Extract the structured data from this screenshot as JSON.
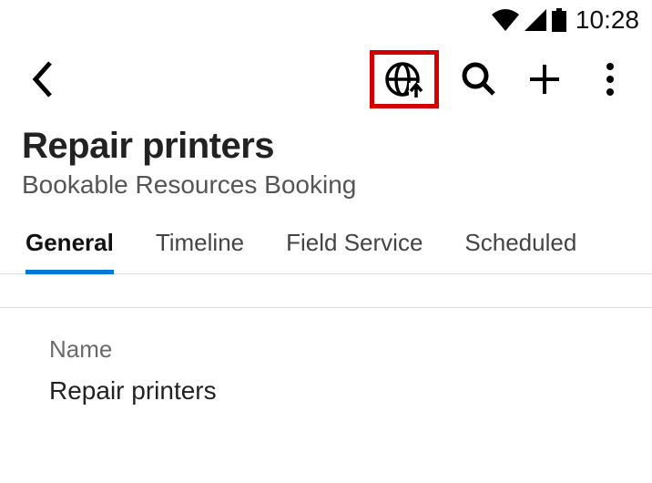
{
  "status": {
    "time": "10:28"
  },
  "appbar": {
    "highlighted_icon": "globe-upload-icon"
  },
  "header": {
    "title": "Repair printers",
    "subtitle": "Bookable Resources Booking"
  },
  "tabs": [
    {
      "label": "General",
      "active": true
    },
    {
      "label": "Timeline",
      "active": false
    },
    {
      "label": "Field Service",
      "active": false
    },
    {
      "label": "Scheduled",
      "active": false
    }
  ],
  "form": {
    "name": {
      "label": "Name",
      "value": "Repair printers"
    }
  }
}
